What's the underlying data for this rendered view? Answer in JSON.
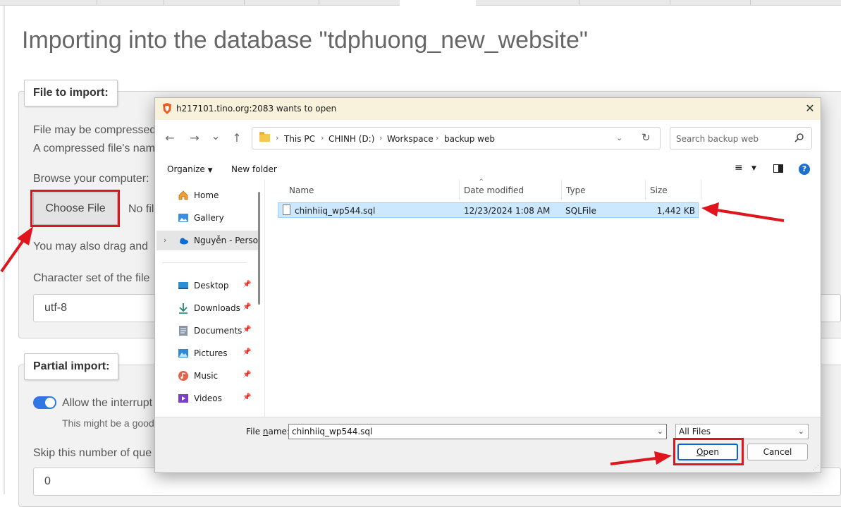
{
  "page": {
    "title": "Importing into the database \"tdphuong_new_website\"",
    "file_section": {
      "legend": "File to import:",
      "line1": "File may be compressed",
      "line2": "A compressed file's nam",
      "browse_label": "Browse your computer:",
      "choose_button": "Choose File",
      "no_file_text": "No fil",
      "drag_text": "You may also drag and",
      "charset_label": "Character set of the file",
      "charset_value": "utf-8"
    },
    "partial_section": {
      "legend": "Partial import:",
      "toggle_label": "Allow the interrupt",
      "hint": "This might be a good",
      "skip_label": "Skip this number of que",
      "skip_value": "0"
    }
  },
  "dialog": {
    "title": "h217101.tino.org:2083 wants to open",
    "close": "✕",
    "nav": {
      "back": "←",
      "forward": "→",
      "recent": "⌄",
      "up": "↑"
    },
    "breadcrumbs": [
      "This PC",
      "CHINH (D:)",
      "Workspace",
      "backup web"
    ],
    "search_placeholder": "Search backup web",
    "commands": {
      "organize": "Organize",
      "new_folder": "New folder",
      "help": "?"
    },
    "nav_items": [
      {
        "label": "Home",
        "icon": "home-icon"
      },
      {
        "label": "Gallery",
        "icon": "gallery-icon"
      },
      {
        "label": "Nguyễn - Personal",
        "icon": "onedrive-icon"
      },
      {
        "label": "Desktop",
        "icon": "desktop-icon"
      },
      {
        "label": "Downloads",
        "icon": "downloads-icon"
      },
      {
        "label": "Documents",
        "icon": "documents-icon"
      },
      {
        "label": "Pictures",
        "icon": "pictures-icon"
      },
      {
        "label": "Music",
        "icon": "music-icon"
      },
      {
        "label": "Videos",
        "icon": "videos-icon"
      }
    ],
    "columns": [
      "Name",
      "Date modified",
      "Type",
      "Size"
    ],
    "files": [
      {
        "name": "chinhiiq_wp544.sql",
        "date": "12/23/2024 1:08 AM",
        "type": "SQLFile",
        "size": "1,442 KB"
      }
    ],
    "file_name_label_pre": "File ",
    "file_name_label_key": "n",
    "file_name_label_post": "ame:",
    "file_name_value": "chinhiiq_wp544.sql",
    "filter_value": "All Files",
    "open_key": "O",
    "open_rest": "pen",
    "cancel_button": "Cancel"
  },
  "colors": {
    "annotation_red": "#e0141c",
    "selection_blue": "#cce8ff",
    "toggle_blue": "#2f78e4",
    "titlebar": "#f8f1db"
  }
}
